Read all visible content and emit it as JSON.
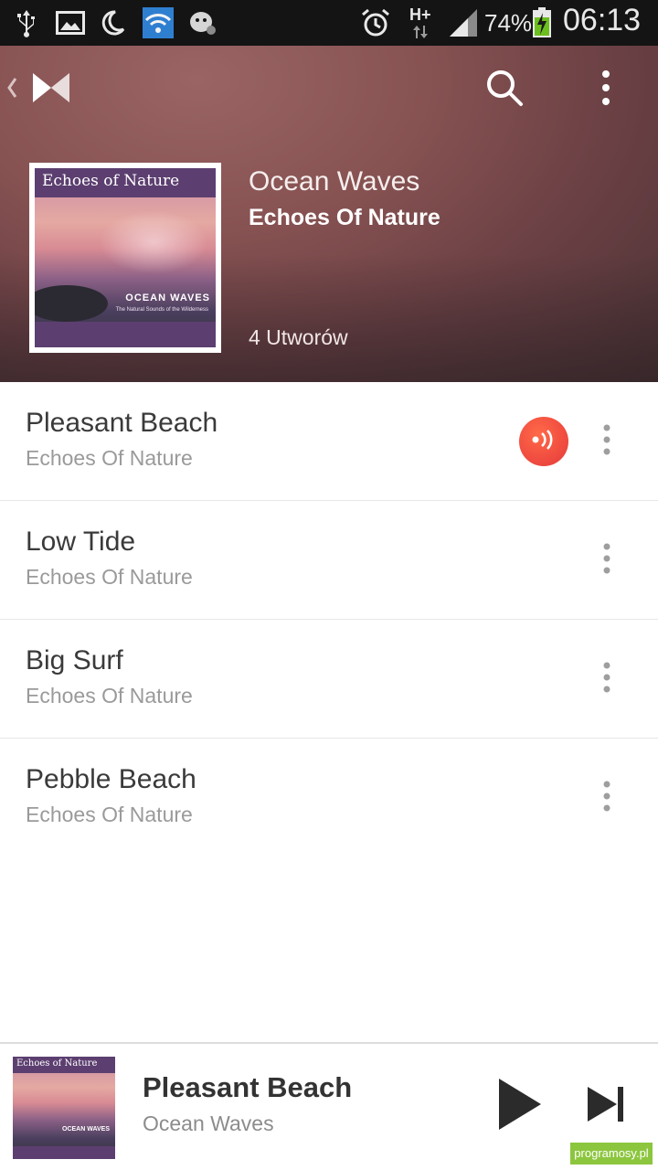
{
  "status_bar": {
    "battery_percent": "74%",
    "time": "06:13",
    "network": "H+",
    "icons": [
      "usb-icon",
      "image-icon",
      "do-not-disturb-moon-icon",
      "wifi-icon",
      "app-dog-icon",
      "alarm-clock-icon",
      "network-hplus-icon",
      "signal-icon",
      "battery-charging-icon"
    ]
  },
  "header": {
    "album_title": "Ocean Waves",
    "album_artist": "Echoes Of Nature",
    "track_count": "4 Utworów",
    "icons": [
      "back-icon",
      "app-logo-icon",
      "search-icon",
      "overflow-menu-icon"
    ]
  },
  "album_art": {
    "banner_text": "Echoes of Nature",
    "subtitle": "OCEAN WAVES",
    "tagline": "The Natural Sounds of the Wilderness"
  },
  "tracks": [
    {
      "title": "Pleasant Beach",
      "artist": "Echoes Of Nature",
      "playing": true
    },
    {
      "title": "Low Tide",
      "artist": "Echoes Of Nature",
      "playing": false
    },
    {
      "title": "Big Surf",
      "artist": "Echoes Of Nature",
      "playing": false
    },
    {
      "title": "Pebble Beach",
      "artist": "Echoes Of Nature",
      "playing": false
    }
  ],
  "mini_player": {
    "title": "Pleasant Beach",
    "subtitle": "Ocean Waves",
    "art_banner_text": "Echoes of Nature",
    "art_subtitle": "OCEAN WAVES",
    "icons": [
      "play-icon",
      "skip-next-icon"
    ]
  },
  "watermark": "programosy.pl",
  "colors": {
    "header_bg": "#875252",
    "now_playing": "#f04c40",
    "watermark_bg": "#8cc63f",
    "title_text": "#3a3a3a",
    "subtitle_text": "#9a9a9a"
  }
}
